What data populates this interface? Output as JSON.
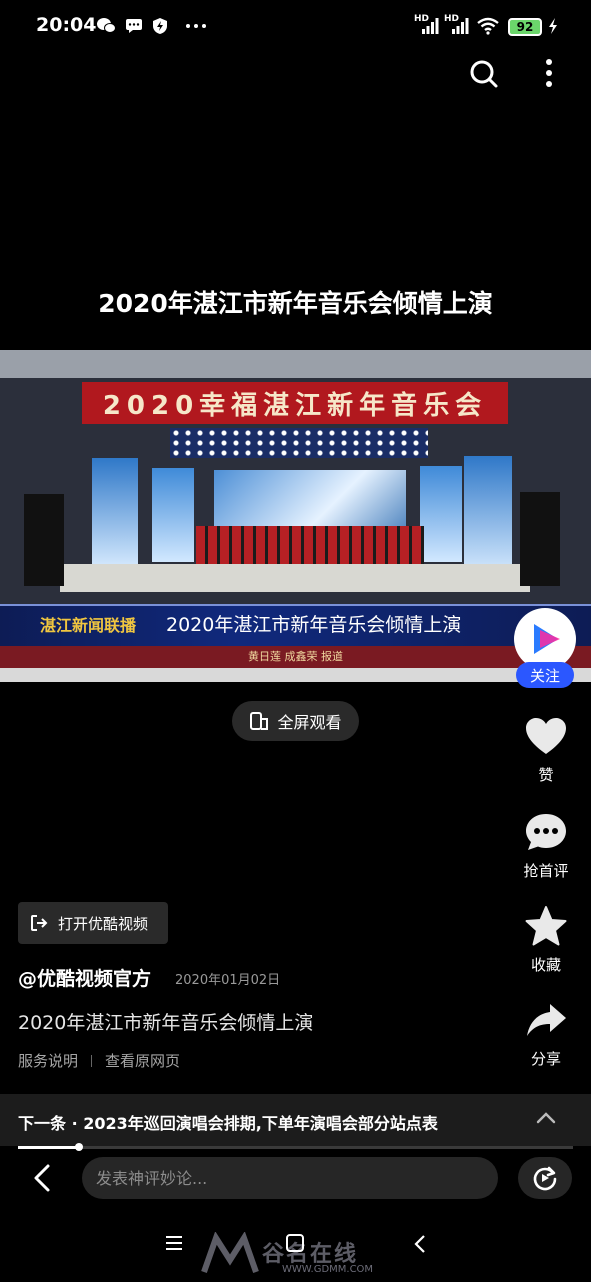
{
  "status_bar": {
    "time": "20:04",
    "battery": "92",
    "signal1": "HD",
    "signal2": "HD",
    "icons": [
      "wechat-icon",
      "message-icon",
      "shield-icon",
      "more-dots-icon",
      "signal-icon",
      "wifi-icon",
      "battery-icon",
      "charging-icon"
    ]
  },
  "header": {
    "icons": [
      "search-icon",
      "more-vertical-icon"
    ]
  },
  "video": {
    "title": "2020年湛江市新年音乐会倾情上演",
    "banner": "2020幸福湛江新年音乐会",
    "news_logo": "湛江新闻联播",
    "lower_third_title": "2020年湛江市新年音乐会倾情上演",
    "credit": "黄日莲 成鑫荣 报道"
  },
  "follow": {
    "label": "关注"
  },
  "fullscreen": {
    "label": "全屏观看"
  },
  "rail": {
    "like": "赞",
    "comment": "抢首评",
    "favorite": "收藏",
    "share": "分享"
  },
  "open_app": {
    "label": "打开优酷视频"
  },
  "meta": {
    "author": "@优酷视频官方",
    "date": "2020年01月02日",
    "description": "2020年湛江市新年音乐会倾情上演",
    "link_service": "服务说明",
    "link_original": "查看原网页"
  },
  "next": {
    "text": "下一条 · 2023年巡回演唱会排期,下单年演唱会部分站点表",
    "progress": 0.11
  },
  "comment": {
    "placeholder": "发表神评妙论..."
  },
  "watermark": {
    "text": "谷名在线",
    "url": "WWW.GDMM.COM"
  },
  "colors": {
    "accent": "#2b57ff",
    "background": "#000000"
  }
}
